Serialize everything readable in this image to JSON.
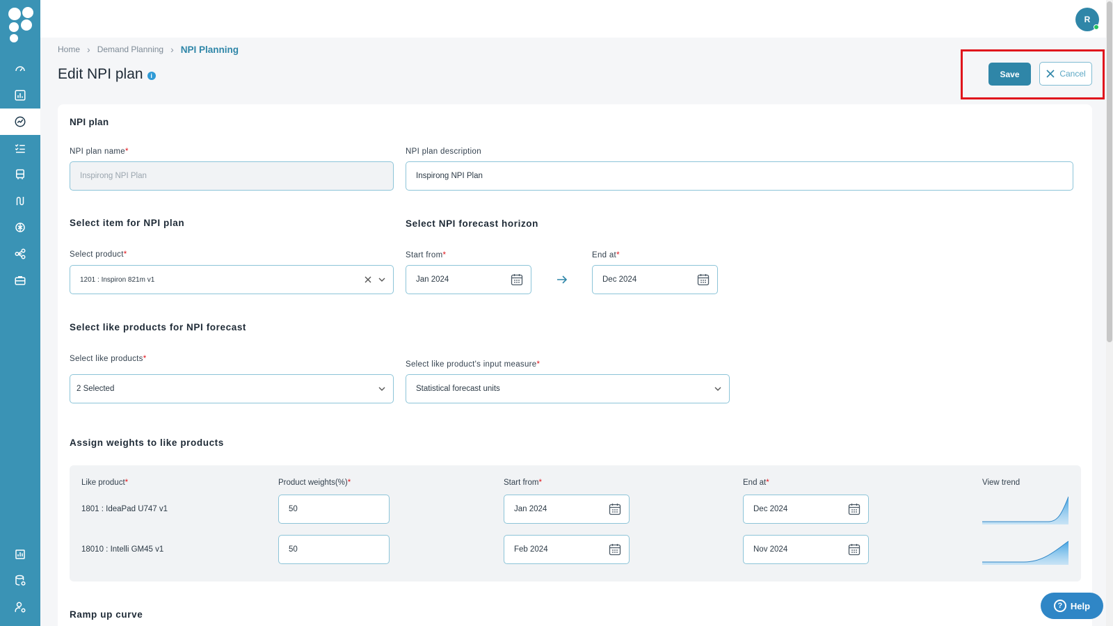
{
  "user": {
    "avatar_initial": "R",
    "online": true
  },
  "breadcrumb": {
    "home": "Home",
    "parent": "Demand Planning",
    "current": "NPI Planning"
  },
  "page": {
    "title": "Edit NPI plan",
    "info_icon": "i"
  },
  "actions": {
    "save_label": "Save",
    "cancel_label": "Cancel"
  },
  "npi_plan": {
    "section_title": "NPI plan",
    "name_label": "NPI plan name",
    "name_value": "Inspirong NPI Plan",
    "description_label": "NPI plan description",
    "description_value": "Inspirong NPI Plan"
  },
  "item_selection": {
    "section_title": "Select item for NPI plan",
    "product_label": "Select product",
    "product_value": "1201 : Inspiron 821m v1"
  },
  "forecast_horizon": {
    "section_title": "Select NPI forecast horizon",
    "start_label": "Start from",
    "start_value": "Jan 2024",
    "end_label": "End at",
    "end_value": "Dec 2024"
  },
  "like_products": {
    "section_title": "Select like products for NPI forecast",
    "like_label": "Select like products",
    "like_value": "2 Selected",
    "measure_label": "Select like product's input measure",
    "measure_value": "Statistical forecast units"
  },
  "weights": {
    "section_title": "Assign weights to like products",
    "headers": {
      "product": "Like product",
      "weight": "Product weights(%)",
      "start": "Start from",
      "end": "End at",
      "trend": "View trend"
    },
    "rows": [
      {
        "product": "1801 : IdeaPad U747 v1",
        "weight": "50",
        "start": "Jan 2024",
        "end": "Dec 2024"
      },
      {
        "product": "18010 : Intelli GM45 v1",
        "weight": "50",
        "start": "Feb 2024",
        "end": "Nov 2024"
      }
    ]
  },
  "ramp_up": {
    "section_title": "Ramp up curve"
  },
  "help": {
    "label": "Help",
    "icon": "?"
  },
  "sidebar_icons": [
    "gauge-icon",
    "bar-chart-icon",
    "trend-icon",
    "checklist-icon",
    "bus-icon",
    "route-icon",
    "ai-icon",
    "network-icon",
    "briefcase-icon",
    "report-icon",
    "database-settings-icon",
    "user-settings-icon"
  ],
  "colors": {
    "sidebar": "#3a93b5",
    "accent": "#2f86a8",
    "required": "#e0151c",
    "highlight": "#e0151c"
  }
}
